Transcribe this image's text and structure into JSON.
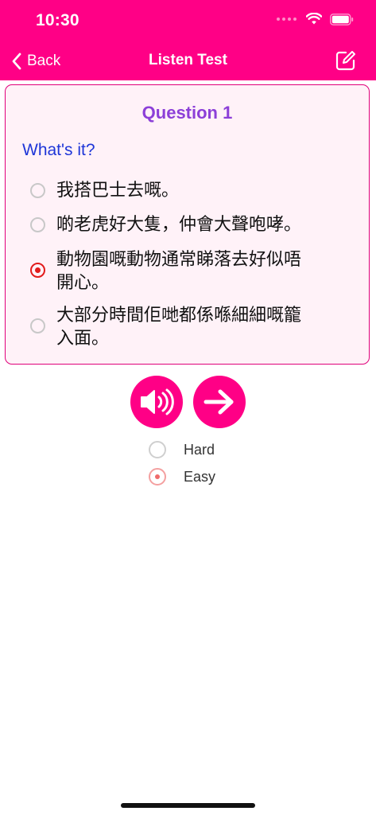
{
  "status_bar": {
    "time": "10:30"
  },
  "nav": {
    "back_label": "Back",
    "title": "Listen Test"
  },
  "question": {
    "title": "Question 1",
    "prompt": "What's it?",
    "options": [
      {
        "text": "我搭巴士去嘅。",
        "selected": false
      },
      {
        "text": "啲老虎好大隻，仲會大聲咆哮。",
        "selected": false
      },
      {
        "text": "動物園嘅動物通常睇落去好似唔開心。",
        "selected": true
      },
      {
        "text": "大部分時間佢哋都係喺細細嘅籠入面。",
        "selected": false
      }
    ]
  },
  "difficulty": {
    "options": [
      {
        "label": "Hard",
        "selected": false
      },
      {
        "label": "Easy",
        "selected": true
      }
    ]
  },
  "colors": {
    "brand": "#ff0086",
    "card_background": "#fff2f8",
    "question_title": "#8c3fd8",
    "prompt": "#1e36d8",
    "selected_radio": "#e21b1b"
  },
  "icons": {
    "back": "chevron-left-icon",
    "edit": "edit-icon",
    "speaker": "speaker-icon",
    "next": "arrow-right-icon"
  }
}
